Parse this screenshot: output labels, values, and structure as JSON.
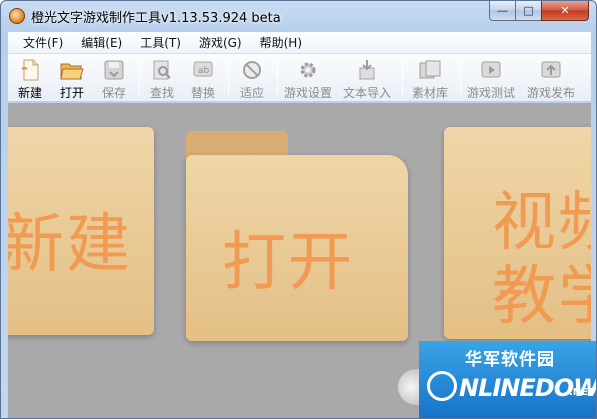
{
  "window": {
    "title": "橙光文字游戏制作工具v1.13.53.924 beta",
    "controls": {
      "minimize": "—",
      "maximize": "□",
      "close": "✕"
    }
  },
  "menu": [
    {
      "label": "文件(F)"
    },
    {
      "label": "编辑(E)"
    },
    {
      "label": "工具(T)"
    },
    {
      "label": "游戏(G)"
    },
    {
      "label": "帮助(H)"
    }
  ],
  "toolbar": [
    {
      "label": "新建",
      "icon": "new-document-icon",
      "enabled": true
    },
    {
      "label": "打开",
      "icon": "open-folder-icon",
      "enabled": true
    },
    {
      "label": "保存",
      "icon": "save-icon",
      "enabled": false
    },
    {
      "label": "查找",
      "icon": "find-icon",
      "enabled": false
    },
    {
      "label": "替换",
      "icon": "replace-icon",
      "enabled": false
    },
    {
      "label": "适应",
      "icon": "fit-icon",
      "enabled": false
    },
    {
      "label": "游戏设置",
      "icon": "gear-icon",
      "enabled": false
    },
    {
      "label": "文本导入",
      "icon": "text-import-icon",
      "enabled": false
    },
    {
      "label": "素材库",
      "icon": "asset-library-icon",
      "enabled": false
    },
    {
      "label": "游戏测试",
      "icon": "game-test-icon",
      "enabled": false
    },
    {
      "label": "游戏发布",
      "icon": "game-publish-icon",
      "enabled": false
    }
  ],
  "start_panel": {
    "new_card": "新建",
    "open_card": "打开",
    "video_card_line1": "视频",
    "video_card_line2": "教学"
  },
  "watermark": {
    "chinese": "华军软件园",
    "english": "NLINEDOWN",
    "suffix": ".NET"
  }
}
